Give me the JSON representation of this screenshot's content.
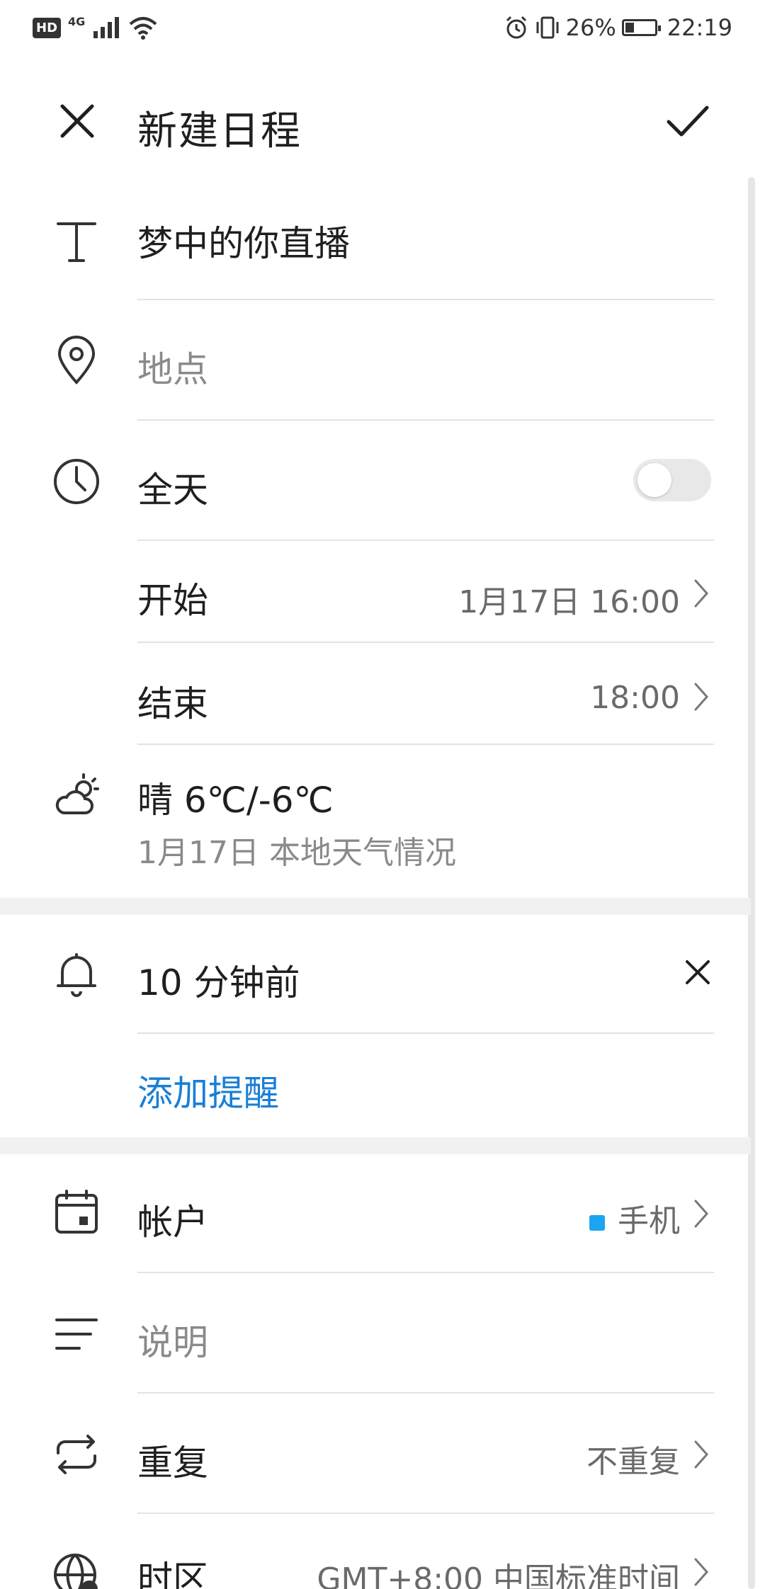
{
  "status_bar": {
    "hd": "HD",
    "network": "4G",
    "battery_percent": "26%",
    "time": "22:19"
  },
  "app_bar": {
    "title": "新建日程",
    "close_icon": "close-icon",
    "confirm_icon": "check-icon"
  },
  "event": {
    "title": "梦中的你直播",
    "location_placeholder": "地点",
    "all_day_label": "全天",
    "all_day_on": false,
    "start_label": "开始",
    "start_value": "1月17日 16:00",
    "end_label": "结束",
    "end_value": "18:00",
    "weather_main": "晴 6℃/-6℃",
    "weather_sub": "1月17日 本地天气情况"
  },
  "reminders": {
    "items": [
      "10 分钟前"
    ],
    "add_label": "添加提醒"
  },
  "details": {
    "account_label": "帐户",
    "account_value": "手机",
    "account_color": "#1aa6f0",
    "description_placeholder": "说明",
    "repeat_label": "重复",
    "repeat_value": "不重复",
    "timezone_label": "时区",
    "timezone_value": "GMT+8:00 中国标准时间"
  },
  "colors": {
    "accent": "#1a7fd6",
    "divider": "#e3e3e3",
    "section_gap": "#f1f1f1"
  }
}
